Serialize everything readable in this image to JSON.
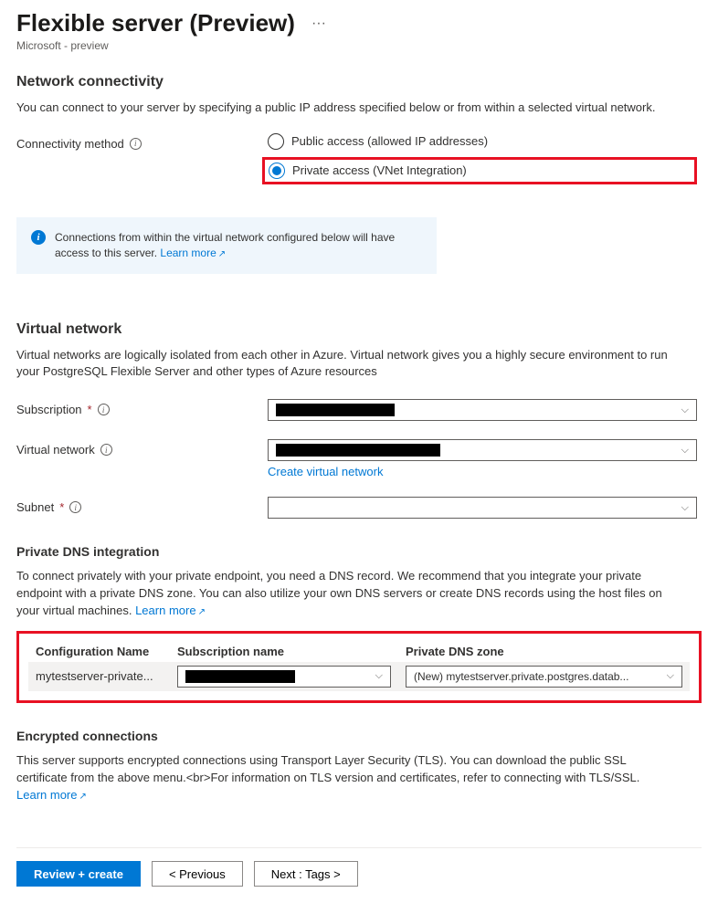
{
  "header": {
    "title": "Flexible server (Preview)",
    "subtitle": "Microsoft - preview"
  },
  "network": {
    "heading": "Network connectivity",
    "desc": "You can connect to your server by specifying a public IP address specified below or from within a selected virtual network.",
    "method_label": "Connectivity method",
    "options": {
      "public": "Public access (allowed IP addresses)",
      "private": "Private access (VNet Integration)"
    },
    "infobox": {
      "text": "Connections from within the virtual network configured below will have access to this server.",
      "link": "Learn more"
    }
  },
  "vnet": {
    "heading": "Virtual network",
    "desc": "Virtual networks are logically isolated from each other in Azure. Virtual network gives you a highly secure environment to run your PostgreSQL Flexible Server and other types of Azure resources",
    "subscription_label": "Subscription",
    "network_label": "Virtual network",
    "create_link": "Create virtual network",
    "subnet_label": "Subnet"
  },
  "dns": {
    "heading": "Private DNS integration",
    "desc_part1": "To connect privately with your private endpoint, you need a DNS record. We recommend that you integrate your private endpoint with a private DNS zone. You can also utilize your own DNS servers or create DNS records using the host files on your virtual machines.",
    "learn_more": "Learn more",
    "cols": {
      "cfg": "Configuration Name",
      "sub": "Subscription name",
      "zone": "Private DNS zone"
    },
    "row": {
      "cfg": "mytestserver-private...",
      "zone": "(New) mytestserver.private.postgres.datab..."
    }
  },
  "tls": {
    "heading": "Encrypted connections",
    "desc": "This server supports encrypted connections using Transport Layer Security (TLS). You can download the public SSL certificate from the above menu.<br>For information on TLS version and certificates, refer to connecting with TLS/SSL.",
    "learn_more": "Learn more"
  },
  "footer": {
    "review": "Review + create",
    "prev": "< Previous",
    "next": "Next : Tags >"
  }
}
